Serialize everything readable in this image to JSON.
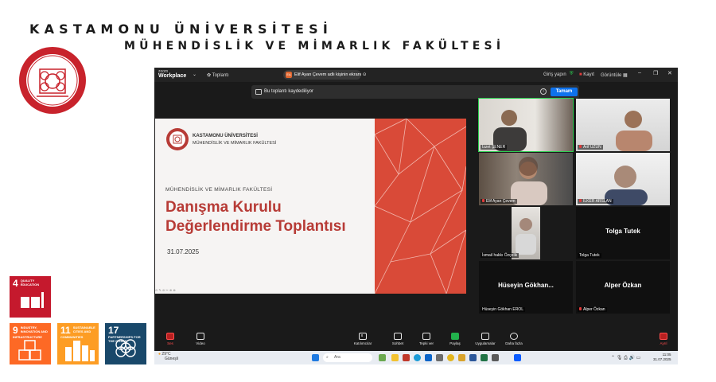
{
  "header": {
    "university": "KASTAMONU ÜNİVERSİTESİ",
    "faculty": "MÜHENDİSLİK VE MİMARLIK FAKÜLTESİ"
  },
  "logo": {
    "icon": "university-seal-icon",
    "color": "#c8232c"
  },
  "sdg": [
    {
      "num": "4",
      "label": "QUALITY EDUCATION",
      "color": "#c5192d",
      "icon": "book-pencil-icon"
    },
    {
      "num": "9",
      "label": "INDUSTRY, INNOVATION AND INFRASTRUCTURE",
      "color": "#fd6925",
      "icon": "cubes-icon"
    },
    {
      "num": "11",
      "label": "SUSTAINABLE CITIES AND COMMUNITIES",
      "color": "#fd9d24",
      "icon": "city-icon"
    },
    {
      "num": "17",
      "label": "PARTNERSHIPS FOR THE GOALS",
      "color": "#19486a",
      "icon": "rings-icon"
    }
  ],
  "zoom": {
    "brand_top": "zoom",
    "brand": "Workplace",
    "meeting_menu": "Toplantı",
    "share_badge": "EA",
    "share_banner": "Elif Ayan Çevem adlı kişinin ekranı",
    "top_right": {
      "signin": "Giriş yapın",
      "record": "Kayıt",
      "view": "Görüntüle"
    },
    "notice": {
      "text": "Bu toplantı kaydediliyor",
      "ok": "Tamam"
    },
    "slide": {
      "university": "KASTAMONU ÜNİVERSİTESİ",
      "faculty": "MÜHENDİSLİK VE MİMARLIK FAKÜLTESİ",
      "small_title": "MÜHENDİSLİK VE MİMARLIK FAKÜLTESİ",
      "title_line1": "Danışma Kurulu",
      "title_line2": "Değerlendirme Toplantısı",
      "date": "31.07.2025",
      "accent": "#d94a38"
    },
    "participants": [
      {
        "name": "İzzet ŞENER",
        "video": true,
        "active": true
      },
      {
        "name": "Arif UZUN",
        "video": true,
        "muted": true
      },
      {
        "name": "Elif Ayan Çevem",
        "video": true,
        "muted": true
      },
      {
        "name": "İLKER ARSLAN",
        "video": true,
        "muted": true
      },
      {
        "name": "İsmail hakkı Özçelik",
        "video": true
      },
      {
        "display": "Tolga Tutek",
        "name": "Tolga Tutek",
        "video": false
      },
      {
        "display": "Hüseyin  Gökhan...",
        "name": "Hüseyin Gökhan EROL",
        "video": false
      },
      {
        "display": "Alper Özkan",
        "name": "Alper Özkan",
        "video": false,
        "muted": true
      }
    ],
    "toolbar": {
      "audio": "Ses",
      "video": "Video",
      "participants": "Katılımcılar",
      "participants_count": "8",
      "chat": "Sohbet",
      "react": "Tepki ver",
      "share": "Paylaş",
      "apps": "Uygulamalar",
      "more": "Daha fazla",
      "leave": "Ayrıl"
    },
    "taskbar": {
      "temp": "29°C",
      "weather": "Güneşli",
      "search": "Ara",
      "time": "11:05",
      "date": "31.07.2025"
    }
  }
}
